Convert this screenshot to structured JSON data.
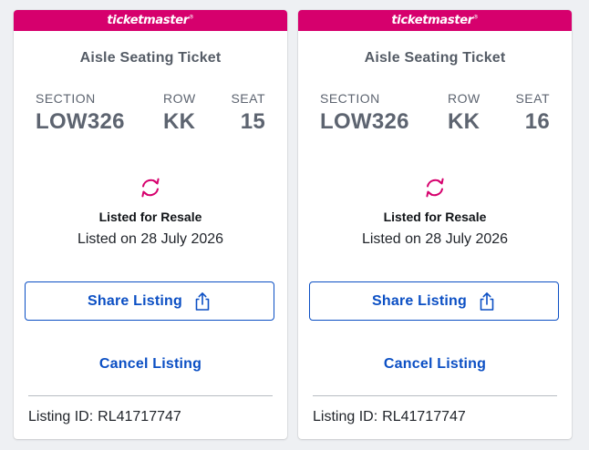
{
  "tickets": [
    {
      "brand": "ticketmaster",
      "type": "Aisle Seating Ticket",
      "section_label": "SECTION",
      "section": "LOW326",
      "row_label": "ROW",
      "row": "KK",
      "seat_label": "SEAT",
      "seat": "15",
      "status": "Listed for Resale",
      "listed_on": "Listed on 28 July 2026",
      "share_label": "Share Listing",
      "cancel_label": "Cancel Listing",
      "listing_id_label": "Listing ID:",
      "listing_id": "RL41717747"
    },
    {
      "brand": "ticketmaster",
      "type": "Aisle Seating Ticket",
      "section_label": "SECTION",
      "section": "LOW326",
      "row_label": "ROW",
      "row": "KK",
      "seat_label": "SEAT",
      "seat": "16",
      "status": "Listed for Resale",
      "listed_on": "Listed on 28 July 2026",
      "share_label": "Share Listing",
      "cancel_label": "Cancel Listing",
      "listing_id_label": "Listing ID:",
      "listing_id": "RL41717747"
    }
  ],
  "icons": {
    "resale": "refresh-arrows-icon",
    "share": "share-upload-icon"
  },
  "colors": {
    "brand": "#d6006d",
    "link": "#0b4fc4",
    "muted_text": "#5d6470"
  }
}
